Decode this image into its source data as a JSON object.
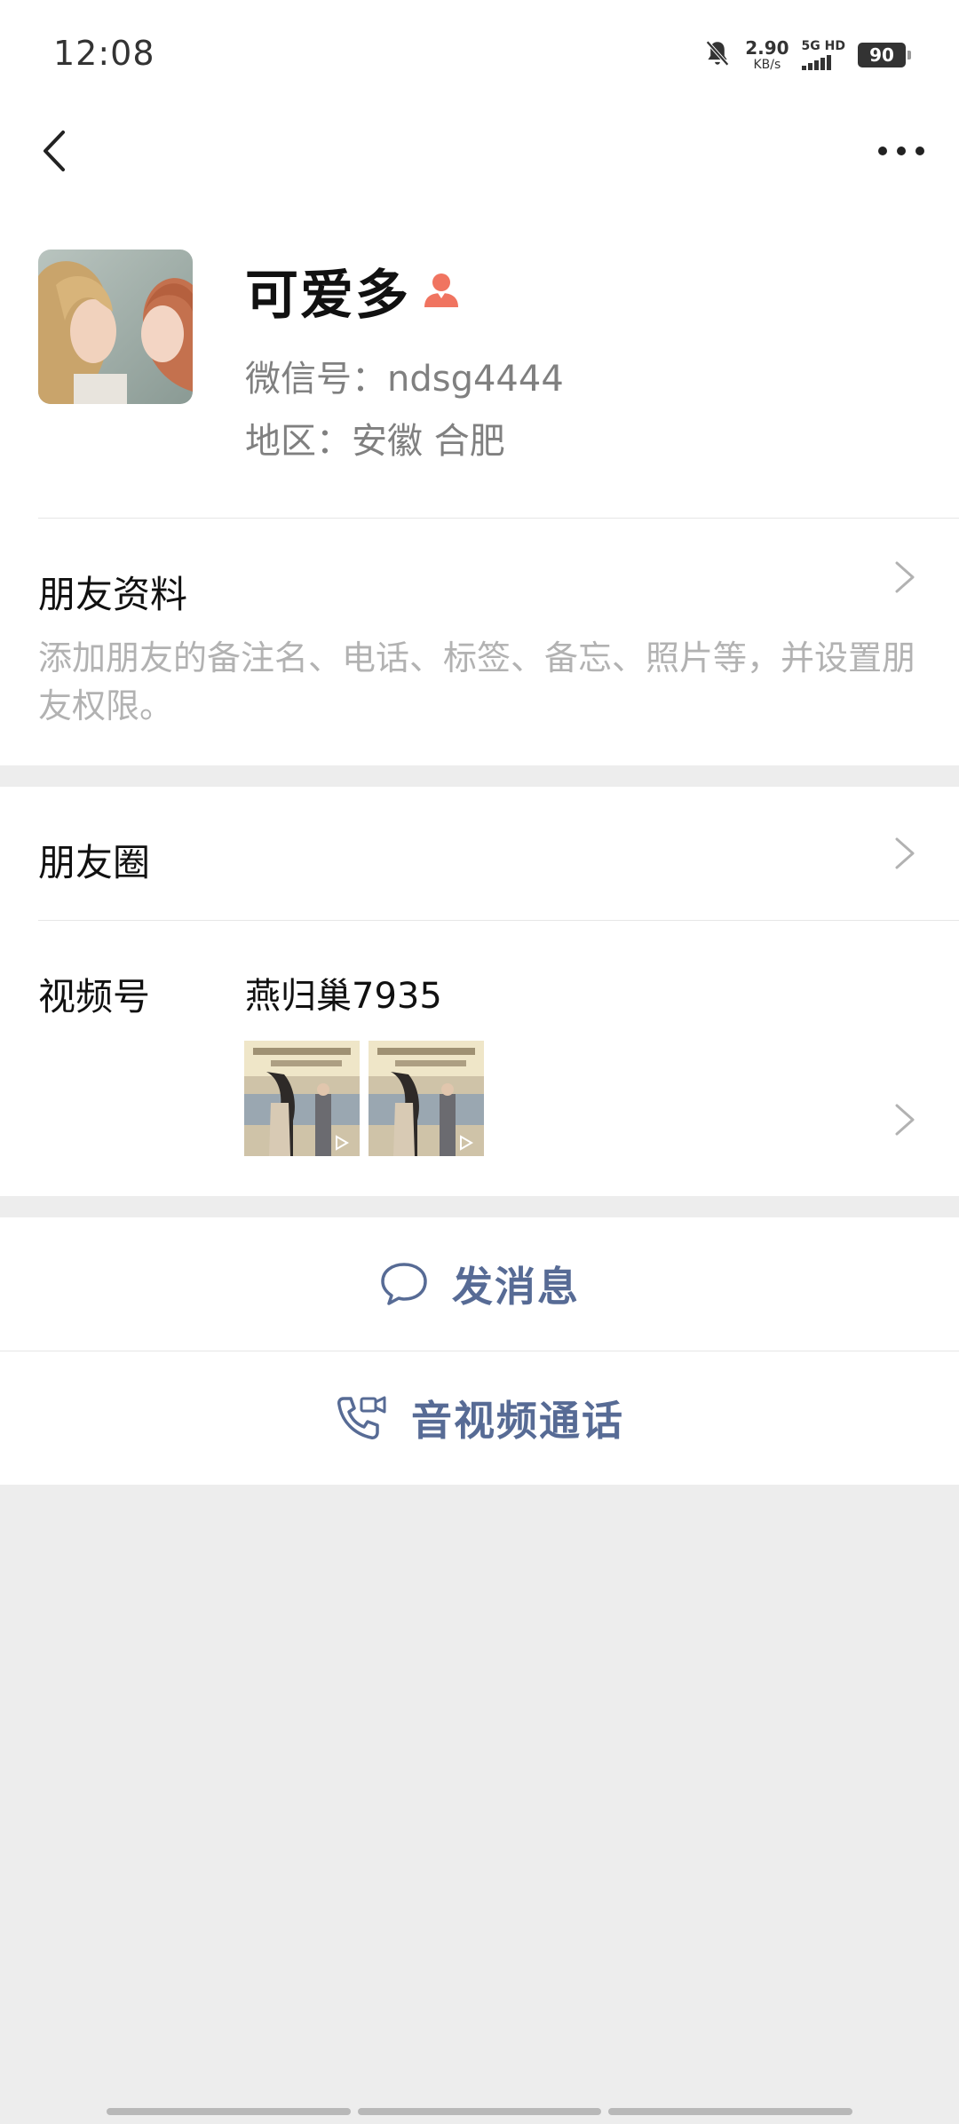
{
  "status_bar": {
    "time": "12:08",
    "net_speed_value": "2.90",
    "net_speed_unit": "KB/s",
    "network_type": "5G HD",
    "battery": "90",
    "icons": [
      "bell-muted-icon",
      "signal-icon",
      "battery-icon"
    ]
  },
  "nav": {
    "back_icon": "chevron-left-icon",
    "more_icon": "more-dots-icon"
  },
  "profile": {
    "nickname": "可爱多",
    "gender_icon": "female-user-icon",
    "wechat_id_line": "微信号：ndsg4444",
    "region_line": "地区：安徽  合肥"
  },
  "friend_info": {
    "title": "朋友资料",
    "description": "添加朋友的备注名、电话、标签、备忘、照片等，并设置朋友权限。"
  },
  "moments": {
    "title": "朋友圈"
  },
  "channels": {
    "title": "视频号",
    "channel_name": "燕归巢7935",
    "thumb_count": 2
  },
  "actions": {
    "send_message": "发消息",
    "av_call": "音视频通话"
  },
  "colors": {
    "accent_link": "#576b95",
    "background": "#ededed",
    "gender_female": "#f07460",
    "secondary_text": "#808080"
  }
}
